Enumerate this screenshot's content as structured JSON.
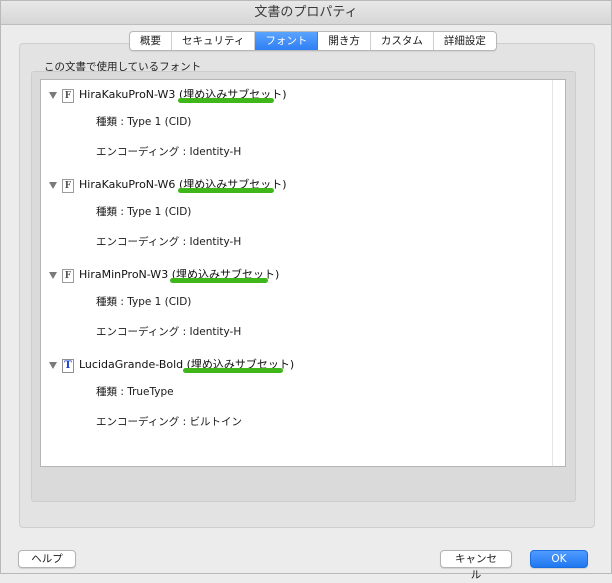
{
  "window": {
    "title": "文書のプロパティ"
  },
  "tabs": [
    {
      "label": "概要",
      "active": false
    },
    {
      "label": "セキュリティ",
      "active": false
    },
    {
      "label": "フォント",
      "active": true
    },
    {
      "label": "開き方",
      "active": false
    },
    {
      "label": "カスタム",
      "active": false
    },
    {
      "label": "詳細設定",
      "active": false
    }
  ],
  "fonts_section": {
    "label": "この文書で使用しているフォント",
    "fonts": [
      {
        "name": "HiraKakuProN-W3",
        "embed_status": "(埋め込みサブセット)",
        "icon": "F",
        "icon_name": "type1-font-icon",
        "type": "種類 : Type 1 (CID)",
        "encoding": "エンコーディング : Identity-H"
      },
      {
        "name": "HiraKakuProN-W6",
        "embed_status": "(埋め込みサブセット)",
        "icon": "F",
        "icon_name": "type1-font-icon",
        "type": "種類 : Type 1 (CID)",
        "encoding": "エンコーディング : Identity-H"
      },
      {
        "name": "HiraMinProN-W3",
        "embed_status": "(埋め込みサブセット)",
        "icon": "F",
        "icon_name": "type1-font-icon",
        "type": "種類 : Type 1 (CID)",
        "encoding": "エンコーディング : Identity-H"
      },
      {
        "name": "LucidaGrande-Bold",
        "embed_status": "(埋め込みサブセット)",
        "icon": "T",
        "icon_name": "truetype-font-icon",
        "type": "種類 : TrueType",
        "encoding": "エンコーディング : ビルトイン"
      }
    ]
  },
  "buttons": {
    "help": "ヘルプ",
    "cancel": "キャンセル",
    "ok": "OK"
  },
  "colors": {
    "accent": "#2f7ff4",
    "highlight": "#3fb71a"
  }
}
